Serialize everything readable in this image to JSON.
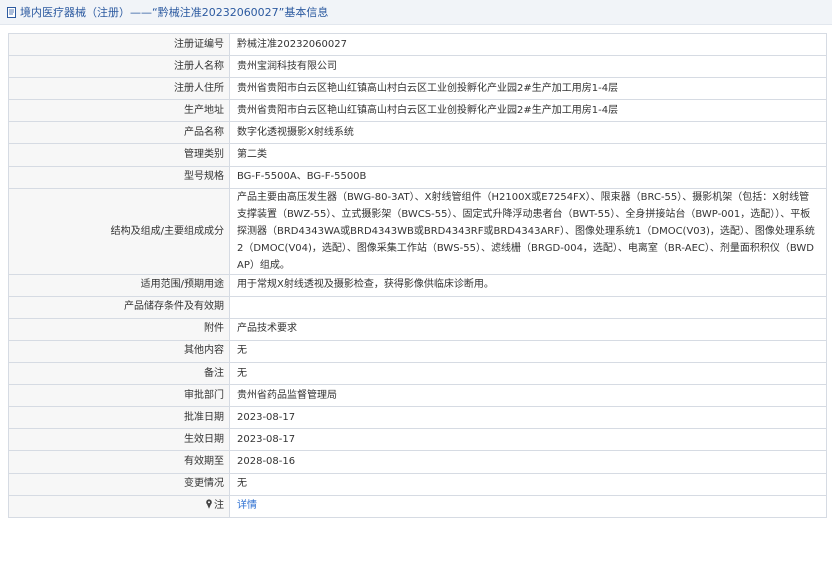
{
  "header": {
    "title": "境内医疗器械（注册）——“黔械注准20232060027”基本信息"
  },
  "rows": [
    {
      "label": "注册证编号",
      "value": "黔械注准20232060027"
    },
    {
      "label": "注册人名称",
      "value": "贵州宝润科技有限公司"
    },
    {
      "label": "注册人住所",
      "value": "贵州省贵阳市白云区艳山红镇高山村白云区工业创投孵化产业园2#生产加工用房1-4层"
    },
    {
      "label": "生产地址",
      "value": "贵州省贵阳市白云区艳山红镇高山村白云区工业创投孵化产业园2#生产加工用房1-4层"
    },
    {
      "label": "产品名称",
      "value": "数字化透视摄影X射线系统"
    },
    {
      "label": "管理类别",
      "value": "第二类"
    },
    {
      "label": "型号规格",
      "value": "BG-F-5500A、BG-F-5500B"
    },
    {
      "label": "结构及组成/主要组成成分",
      "value": "产品主要由高压发生器（BWG-80-3AT）、X射线管组件（H2100X或E7254FX）、限束器（BRC-55）、摄影机架（包括：X射线管支撑装置（BWZ-55）、立式摄影架（BWCS-55）、固定式升降浮动患者台（BWT-55）、全身拼接站台（BWP-001，选配））、平板探测器（BRD4343WA或BRD4343WB或BRD4343RF或BRD4343ARF）、图像处理系统1（DMOC(V03)，选配）、图像处理系统2（DMOC(V04)，选配）、图像采集工作站（BWS-55）、滤线栅（BRGD-004，选配）、电离室（BR-AEC）、剂量面积积仪（BWDAP）组成。"
    },
    {
      "label": "适用范围/预期用途",
      "value": "用于常规X射线透视及摄影检查，获得影像供临床诊断用。"
    },
    {
      "label": "产品储存条件及有效期",
      "value": ""
    },
    {
      "label": "附件",
      "value": "产品技术要求"
    },
    {
      "label": "其他内容",
      "value": "无"
    },
    {
      "label": "备注",
      "value": "无"
    },
    {
      "label": "审批部门",
      "value": "贵州省药品监督管理局"
    },
    {
      "label": "批准日期",
      "value": "2023-08-17"
    },
    {
      "label": "生效日期",
      "value": "2023-08-17"
    },
    {
      "label": "有效期至",
      "value": "2028-08-16"
    },
    {
      "label": "变更情况",
      "value": "无"
    }
  ],
  "note": {
    "label": "注",
    "icon": "pin-icon",
    "link_text": "详情"
  },
  "colors": {
    "header_bg": "#f1f4f8",
    "title_color": "#2c5aa0",
    "label_bg": "#f7f7f7",
    "border": "#d6dbe3",
    "link": "#2c6fd1"
  }
}
